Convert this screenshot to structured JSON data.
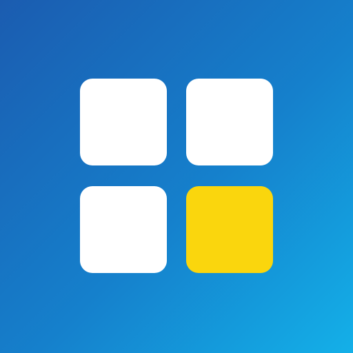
{
  "icon": {
    "name": "grid-app-icon",
    "colors": {
      "gradient_start": "#1b5cb0",
      "gradient_mid": "#1580cc",
      "gradient_end": "#14b0e8",
      "tile_white": "#ffffff",
      "tile_accent": "#fad60d"
    },
    "tiles": [
      {
        "id": "top-left",
        "color": "#ffffff"
      },
      {
        "id": "top-right",
        "color": "#ffffff"
      },
      {
        "id": "bottom-left",
        "color": "#ffffff"
      },
      {
        "id": "bottom-right",
        "color": "#fad60d"
      }
    ]
  }
}
